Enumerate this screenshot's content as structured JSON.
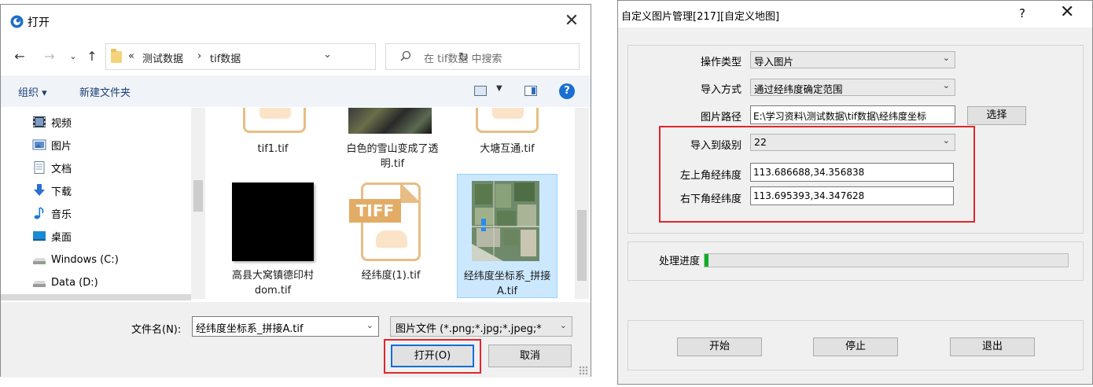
{
  "open_dialog": {
    "title": "打开",
    "address": {
      "chevron": "«",
      "path": [
        "测试数据",
        "tif数据"
      ],
      "separator": "›"
    },
    "search_placeholder": "在 tif数据 中搜索",
    "toolbar": {
      "organize": "组织 ▾",
      "new_folder": "新建文件夹"
    },
    "nav_items": [
      {
        "label": "视频",
        "icon": "video-icon"
      },
      {
        "label": "图片",
        "icon": "pictures-icon"
      },
      {
        "label": "文档",
        "icon": "documents-icon"
      },
      {
        "label": "下载",
        "icon": "download-icon"
      },
      {
        "label": "音乐",
        "icon": "music-icon"
      },
      {
        "label": "桌面",
        "icon": "desktop-icon"
      },
      {
        "label": "Windows (C:)",
        "icon": "drive-icon"
      },
      {
        "label": "Data (D:)",
        "icon": "drive-icon"
      }
    ],
    "files_row1": [
      {
        "label": "tif1.tif"
      },
      {
        "label": "白色的雪山变成了透明.tif"
      },
      {
        "label": "大塘互通.tif"
      }
    ],
    "files_row2": [
      {
        "label": "高县大窝镇德印村dom.tif",
        "thumb": "black-image"
      },
      {
        "label": "经纬度(1).tif",
        "thumb": "tiff-document"
      },
      {
        "label": "经纬度坐标系_拼接A.tif",
        "thumb": "satellite-image",
        "selected": true
      }
    ],
    "tiff_badge": "TIFF",
    "filename_label": "文件名(N):",
    "filename_value": "经纬度坐标系_拼接A.tif",
    "filetype_value": "图片文件 (*.png;*.jpg;*.jpeg;*",
    "open_button": "打开(O)",
    "cancel_button": "取消",
    "colors": {
      "highlight": "#e0262b",
      "accent": "#0f6fd6"
    }
  },
  "manager_dialog": {
    "title": "自定义图片管理[217][自定义地图]",
    "help": "?",
    "close": "✕",
    "operation_type": {
      "label": "操作类型",
      "value": "导入图片"
    },
    "import_mode": {
      "label": "导入方式",
      "value": "通过经纬度确定范围"
    },
    "image_path": {
      "label": "图片路径",
      "value": "E:\\学习资料\\测试数据\\tif数据\\经纬度坐标",
      "button": "选择"
    },
    "import_level": {
      "label": "导入到级别",
      "value": "22"
    },
    "top_left": {
      "label": "左上角经纬度",
      "value": "113.686688,34.356838"
    },
    "bottom_right": {
      "label": "右下角经纬度",
      "value": "113.695393,34.347628"
    },
    "progress": {
      "label": "处理进度",
      "value": 0.01,
      "color": "#06b025"
    },
    "buttons": {
      "start": "开始",
      "stop": "停止",
      "exit": "退出"
    }
  }
}
